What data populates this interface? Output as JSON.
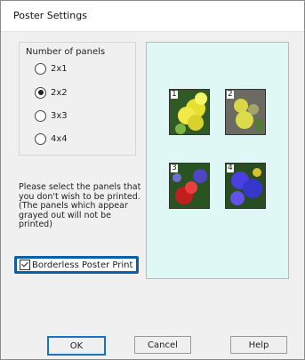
{
  "window": {
    "title": "Poster Settings"
  },
  "panels": {
    "legend": "Number of panels",
    "options": [
      "2x1",
      "2x2",
      "3x3",
      "4x4"
    ],
    "selected": "2x2"
  },
  "hint_text": "Please select the panels that you don't wish to be printed. (The panels which appear grayed out will not be printed)",
  "preview": {
    "tiles": [
      {
        "label": "1"
      },
      {
        "label": "2"
      },
      {
        "label": "3"
      },
      {
        "label": "4"
      }
    ]
  },
  "checkbox": {
    "label": "Borderless Poster Print",
    "checked": true
  },
  "buttons": {
    "ok": "OK",
    "cancel": "Cancel",
    "help": "Help"
  }
}
